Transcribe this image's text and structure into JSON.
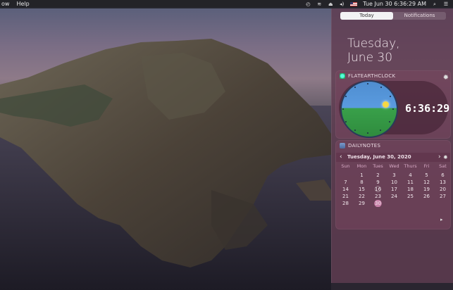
{
  "menubar": {
    "left_items": [
      "ow",
      "Help"
    ],
    "clock": "Tue Jun 30  6:36:29 AM",
    "icons": [
      "time-machine-icon",
      "wifi-icon",
      "eject-icon",
      "volume-icon",
      "flag-icon",
      "search-icon",
      "control-center-icon"
    ]
  },
  "notification_center": {
    "tabs": [
      "Today",
      "Notifications"
    ],
    "active_tab": "Today",
    "date_line1": "Tuesday,",
    "date_line2": "June 30",
    "widgets": {
      "clock": {
        "title": "FLATEARTHCLOCK",
        "time": "6:36:29"
      },
      "calendar": {
        "title": "DAILYNOTES",
        "month_title": "Tuesday, June 30, 2020",
        "weekdays": [
          "Sun",
          "Mon",
          "Tues",
          "Wed",
          "Thurs",
          "Fri",
          "Sat"
        ],
        "weeks": [
          [
            "",
            "1",
            "2",
            "3",
            "4",
            "5",
            "6"
          ],
          [
            "7",
            "8",
            "9",
            "10",
            "11",
            "12",
            "13"
          ],
          [
            "14",
            "15",
            "16",
            "17",
            "18",
            "19",
            "20"
          ],
          [
            "21",
            "22",
            "23",
            "24",
            "25",
            "26",
            "27"
          ],
          [
            "28",
            "29",
            "30",
            "",
            "",
            "",
            ""
          ]
        ],
        "today": "30"
      }
    }
  },
  "colors": {
    "panel": "#5f3c50",
    "accent": "#c880a8"
  }
}
